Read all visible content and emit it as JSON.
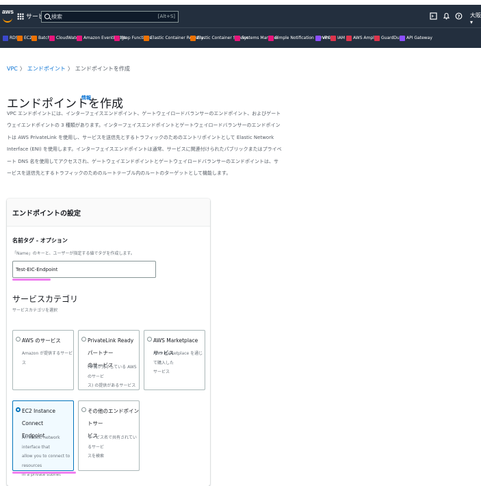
{
  "topbar": {
    "logo_text": "aws",
    "services_label": "サービス",
    "search_placeholder": "検索",
    "search_shortcut": "[Alt+S]",
    "region_label": "大阪 ▾",
    "icons": [
      "grid-icon",
      "search-icon",
      "cloudshell-icon",
      "bell-icon",
      "help-icon"
    ]
  },
  "favorites": [
    {
      "label": "RDS",
      "color": "#3b48cc"
    },
    {
      "label": "EC2",
      "color": "#ed7100"
    },
    {
      "label": "Batch",
      "color": "#ed7100"
    },
    {
      "label": "CloudWatch",
      "color": "#e7157b"
    },
    {
      "label": "Amazon EventBridge",
      "color": "#e7157b"
    },
    {
      "label": "Step Functions",
      "color": "#e7157b"
    },
    {
      "label": "Elastic Container Registry",
      "color": "#ed7100"
    },
    {
      "label": "Elastic Container Service",
      "color": "#ed7100"
    },
    {
      "label": "Systems Manager",
      "color": "#e7157b"
    },
    {
      "label": "Simple Notification Service",
      "color": "#e7157b"
    },
    {
      "label": "VPC",
      "color": "#8c4fff"
    },
    {
      "label": "IAM",
      "color": "#dd344c"
    },
    {
      "label": "AWS Amplify",
      "color": "#dd344c"
    },
    {
      "label": "GuardDuty",
      "color": "#dd344c"
    },
    {
      "label": "API Gateway",
      "color": "#8c4fff"
    }
  ],
  "breadcrumb": {
    "items": [
      "VPC",
      "エンドポイント",
      "エンドポイントを作成"
    ],
    "separator": "〉"
  },
  "page": {
    "title": "エンドポイントを作成",
    "info_link": "情報",
    "description_lines": [
      "VPC エンドポイントには、インターフェイスエンドポイント、ゲートウェイロードバランサーのエンドポイント、およびゲート",
      "ウェイエンドポイントの 3 種類があります。インターフェイスエンドポイントとゲートウェイロードバランサーのエンドポイン",
      "トは AWS PrivateLink を使用し、サービスを送信先とするトラフィックのためのエントリポイントとして Elastic Network",
      "Interface (ENI) を使用します。インターフェイスエンドポイントは通常、サービスに関連付けられたパブリックまたはプライベ",
      "ート DNS 名を使用してアクセスされ、ゲートウェイエンドポイントとゲートウェイロードバランサーのエンドポイントは、サ",
      "ービスを送信先とするトラフィックのためのルートテーブル内のルートのターゲットとして機能します。"
    ]
  },
  "settings": {
    "panel_title": "エンドポイントの設定",
    "name_tag": {
      "label": "名前タグ - オプション",
      "description": "「Name」のキーと、ユーザーが指定する値でタグを作成します。",
      "value": "Test-EIC-Endpoint"
    },
    "service_category": {
      "title": "サービスカテゴリ",
      "description": "サービスカテゴリを選択",
      "options": [
        {
          "title_lines": [
            "AWS のサービス"
          ],
          "desc_lines": [
            "Amazon が提供するサービス"
          ],
          "selected": false
        },
        {
          "title_lines": [
            "PrivateLink Ready パートナー",
            "のサービス"
          ],
          "desc_lines": [
            "(準備が完了している AWS のサービ",
            "ス) の提供があるサービス"
          ],
          "selected": false
        },
        {
          "title_lines": [
            "AWS Marketplace サービス"
          ],
          "desc_lines": [
            "AWS Marketplace を通じて購入した",
            "サービス"
          ],
          "selected": false
        },
        {
          "title_lines": [
            "EC2 Instance Connect",
            "Endpoint"
          ],
          "desc_lines": [
            "An elastic network interface that",
            "allow you to connect to resources",
            "in a private subnet"
          ],
          "selected": true
        },
        {
          "title_lines": [
            "その他のエンドポイントサー",
            "ビス"
          ],
          "desc_lines": [
            "サービス名で共有されているサービ",
            "スを検索"
          ],
          "selected": false
        }
      ]
    }
  },
  "colors": {
    "nav_bg": "#232f3e",
    "link": "#0972d3",
    "selected_border": "#0073bb",
    "highlight": "#f07ff0"
  }
}
